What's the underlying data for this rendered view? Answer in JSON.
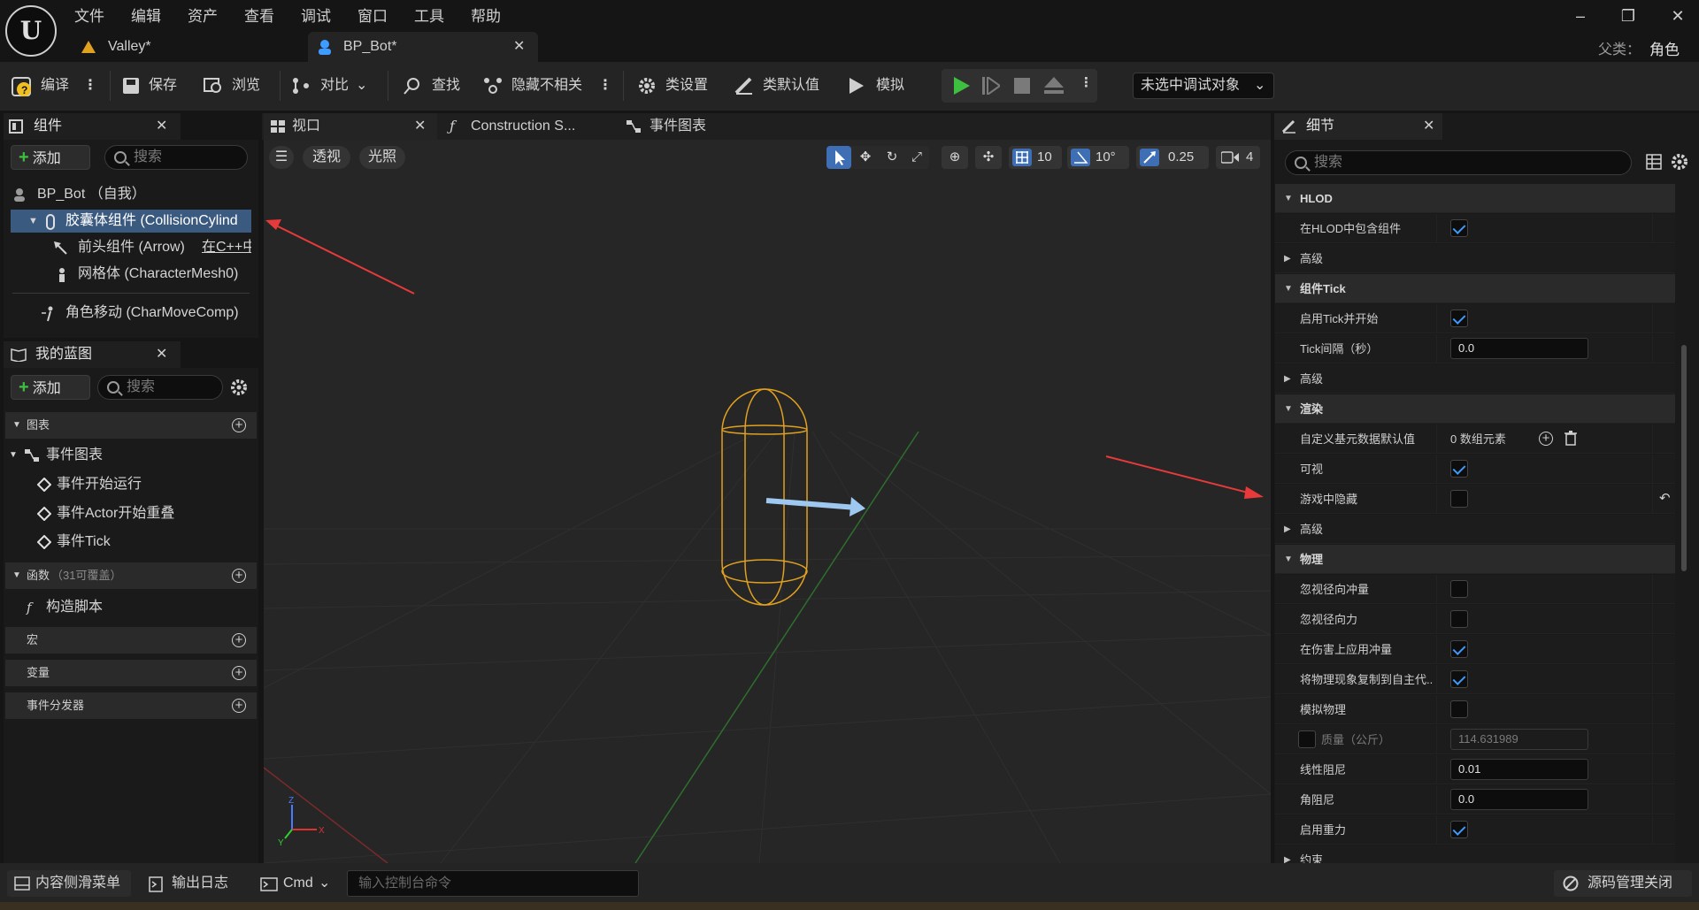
{
  "menu": [
    "文件",
    "编辑",
    "资产",
    "查看",
    "调试",
    "窗口",
    "工具",
    "帮助"
  ],
  "tabs": [
    {
      "label": "Valley*"
    },
    {
      "label": "BP_Bot*"
    }
  ],
  "parent_class": {
    "label": "父类：",
    "value": "角色"
  },
  "toolbar": {
    "compile": "编译",
    "save": "保存",
    "browse": "浏览",
    "diff": "对比",
    "find": "查找",
    "hide_unrelated": "隐藏不相关",
    "class_settings": "类设置",
    "class_defaults": "类默认值",
    "simulate": "模拟",
    "debug_target": "未选中调试对象"
  },
  "components": {
    "title": "组件",
    "add": "添加",
    "search_placeholder": "搜索",
    "items": [
      {
        "label": "BP_Bot （自我）"
      },
      {
        "label": "胶囊体组件 (CollisionCylind"
      },
      {
        "label": "前头组件 (Arrow)",
        "extra": "在C++中"
      },
      {
        "label": "网格体 (CharacterMesh0)"
      },
      {
        "label": "角色移动 (CharMoveComp)"
      }
    ]
  },
  "my_blueprint": {
    "title": "我的蓝图",
    "add": "添加",
    "search_placeholder": "搜索",
    "graphs_label": "图表",
    "event_graph": "事件图表",
    "events": [
      "事件开始运行",
      "事件Actor开始重叠",
      "事件Tick"
    ],
    "functions_label": "函数",
    "functions_count": "（31可覆盖）",
    "construction_script": "构造脚本",
    "macros": "宏",
    "variables": "变量",
    "dispatchers": "事件分发器"
  },
  "viewport": {
    "tabs": [
      "视口",
      "Construction S...",
      "事件图表"
    ],
    "perspective": "透视",
    "lighting": "光照",
    "grid_snap": "10",
    "rot_snap": "10°",
    "scale_snap": "0.25",
    "cam_speed": "4"
  },
  "details": {
    "title": "细节",
    "search_placeholder": "搜索",
    "rows": [
      {
        "type": "cat",
        "label": "HLOD"
      },
      {
        "type": "chk",
        "label": "在HLOD中包含组件",
        "checked": true
      },
      {
        "type": "sub",
        "label": "高级"
      },
      {
        "type": "cat",
        "label": "组件Tick"
      },
      {
        "type": "chk",
        "label": "启用Tick并开始",
        "checked": true
      },
      {
        "type": "num",
        "label": "Tick间隔（秒）",
        "value": "0.0"
      },
      {
        "type": "sub",
        "label": "高级"
      },
      {
        "type": "cat",
        "label": "渲染"
      },
      {
        "type": "arr",
        "label": "自定义基元数据默认值",
        "value": "0 数组元素"
      },
      {
        "type": "chk",
        "label": "可视",
        "checked": true
      },
      {
        "type": "chk",
        "label": "游戏中隐藏",
        "checked": false,
        "reset": true
      },
      {
        "type": "sub",
        "label": "高级"
      },
      {
        "type": "cat",
        "label": "物理"
      },
      {
        "type": "chk",
        "label": "忽视径向冲量",
        "checked": false
      },
      {
        "type": "chk",
        "label": "忽视径向力",
        "checked": false
      },
      {
        "type": "chk",
        "label": "在伤害上应用冲量",
        "checked": true
      },
      {
        "type": "chk",
        "label": "将物理现象复制到自主代...",
        "checked": true
      },
      {
        "type": "chk",
        "label": "模拟物理",
        "checked": false
      },
      {
        "type": "mass",
        "label": "质量（公斤）",
        "value": "114.631989"
      },
      {
        "type": "num",
        "label": "线性阻尼",
        "value": "0.01"
      },
      {
        "type": "num",
        "label": "角阻尼",
        "value": "0.0"
      },
      {
        "type": "chk",
        "label": "启用重力",
        "checked": true
      },
      {
        "type": "sub",
        "label": "约束"
      }
    ]
  },
  "bottom": {
    "content_drawer": "内容侧滑菜单",
    "output_log": "输出日志",
    "cmd": "Cmd",
    "console_placeholder": "输入控制台命令",
    "source_control": "源码管理关闭"
  },
  "colors": {
    "capsule": "#e0a020",
    "arrow": "#9ec8f0",
    "accent": "#3e9bff",
    "play": "#3fbf3f"
  }
}
